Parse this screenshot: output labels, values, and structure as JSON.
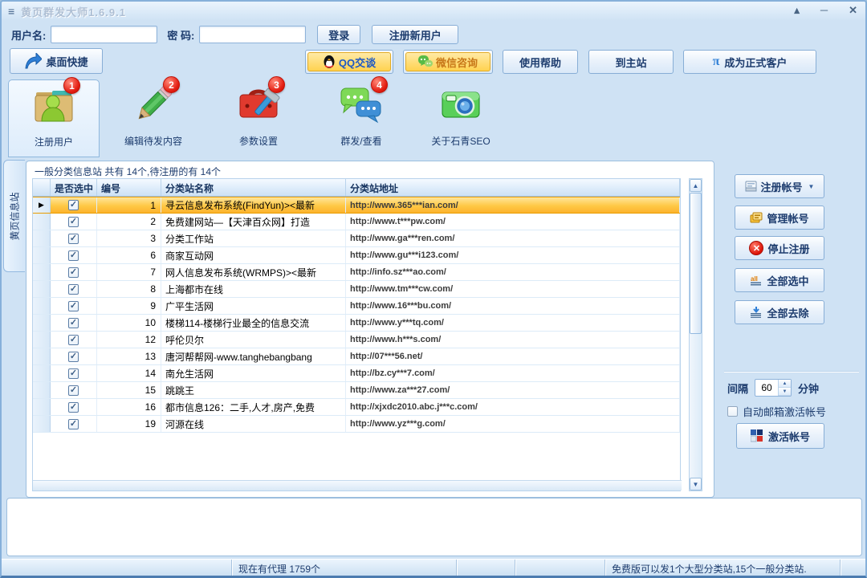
{
  "window": {
    "title": "黄页群发大师1.6.9.1",
    "controls": {
      "rollup": "▴",
      "minimize": "─",
      "close": "✕"
    }
  },
  "login": {
    "username_label": "用户名:",
    "password_label": "密  码:",
    "login_button": "登录",
    "register_button": "注册新用户"
  },
  "quickbar": {
    "desktop_shortcut": "桌面快捷",
    "qq_chat": "QQ交谈",
    "wechat": "微信咨询",
    "help": "使用帮助",
    "main_site": "到主站",
    "pi": "π",
    "become_customer": "成为正式客户"
  },
  "toolbar": {
    "items": [
      {
        "label": "注册用户",
        "badge": "1"
      },
      {
        "label": "编辑待发内容",
        "badge": "2"
      },
      {
        "label": "参数设置",
        "badge": "3"
      },
      {
        "label": "群发/查看",
        "badge": "4"
      },
      {
        "label": "关于石青SEO"
      }
    ]
  },
  "side_tab": {
    "label": "黄页信息站"
  },
  "main": {
    "group_title": "一般分类信息站 共有 14个,待注册的有 14个",
    "table": {
      "columns": [
        "是否选中",
        "编号",
        "分类站名称",
        "分类站地址"
      ],
      "rows": [
        {
          "checked": true,
          "selected": true,
          "id": "1",
          "name": "寻云信息发布系统(FindYun)><最新",
          "url": "http://www.365***ian.com/"
        },
        {
          "checked": true,
          "id": "2",
          "name": "免费建网站—【天津百众网】打造",
          "url": "http://www.t***pw.com/"
        },
        {
          "checked": true,
          "id": "3",
          "name": "分类工作站",
          "url": "http://www.ga***ren.com/"
        },
        {
          "checked": true,
          "id": "6",
          "name": "商家互动网",
          "url": "http://www.gu***i123.com/"
        },
        {
          "checked": true,
          "id": "7",
          "name": "网人信息发布系统(WRMPS)><最新",
          "url": "http://info.sz***ao.com/"
        },
        {
          "checked": true,
          "id": "8",
          "name": "上海都市在线",
          "url": "http://www.tm***cw.com/"
        },
        {
          "checked": true,
          "id": "9",
          "name": "广平生活网",
          "url": "http://www.16***bu.com/"
        },
        {
          "checked": true,
          "id": "10",
          "name": "楼梯114-楼梯行业最全的信息交流",
          "url": "http://www.y***tq.com/"
        },
        {
          "checked": true,
          "id": "12",
          "name": "呼伦贝尔",
          "url": "http://www.h***s.com/"
        },
        {
          "checked": true,
          "id": "13",
          "name": "唐河帮帮网-www.tanghebangbang",
          "url": "http://07***56.net/"
        },
        {
          "checked": true,
          "id": "14",
          "name": "南允生活网",
          "url": "http://bz.cy***7.com/"
        },
        {
          "checked": true,
          "id": "15",
          "name": "跳跳王",
          "url": "http://www.za***27.com/"
        },
        {
          "checked": true,
          "id": "16",
          "name": "都市信息126：二手,人才,房产,免费",
          "url": "http://xjxdc2010.abc.j***c.com/"
        },
        {
          "checked": true,
          "id": "19",
          "name": "河源在线",
          "url": "http://www.yz***g.com/"
        }
      ]
    }
  },
  "right_panel": {
    "register_button": "注册帐号",
    "manage_button": "管理帐号",
    "stop_button": "停止注册",
    "select_all_button": "全部选中",
    "deselect_all_button": "全部去除",
    "interval_label": "间隔",
    "interval_value": "60",
    "interval_unit": "分钟",
    "auto_email_checkbox": "自动邮箱激活帐号",
    "activate_button": "激活帐号"
  },
  "status_bar": {
    "agents": "现在有代理 1759个",
    "free_version": "免费版可以发1个大型分类站,15个一般分类站."
  }
}
